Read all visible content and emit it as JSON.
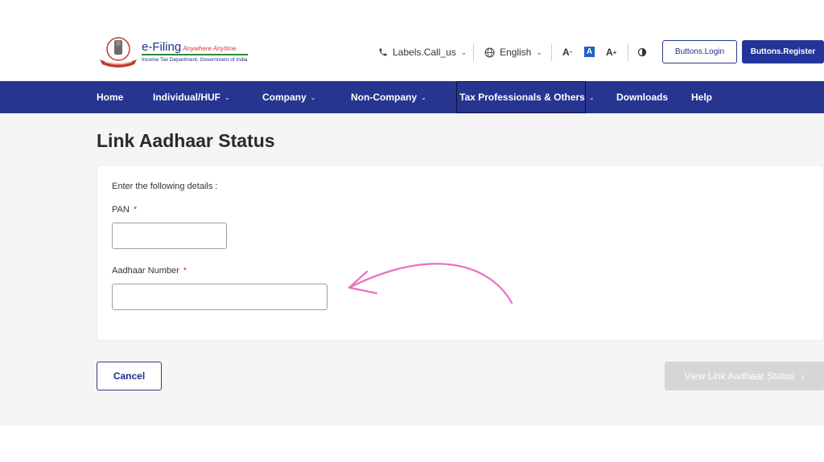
{
  "header": {
    "logo": {
      "brand": "e-Filing",
      "tagline": "Anywhere Anytime",
      "subtitle": "Income Tax Department, Government of India"
    },
    "call_us": "Labels.Call_us",
    "language": "English",
    "font_decrease": "A",
    "font_default": "A",
    "font_increase": "A",
    "login_label": "Buttons.Login",
    "register_label": "Buttons.Register"
  },
  "nav": {
    "items": [
      {
        "label": "Home"
      },
      {
        "label": "Individual/HUF"
      },
      {
        "label": "Company"
      },
      {
        "label": "Non-Company"
      },
      {
        "label": "Tax Professionals & Others"
      },
      {
        "label": "Downloads"
      },
      {
        "label": "Help"
      }
    ]
  },
  "page": {
    "title": "Link Aadhaar Status",
    "intro": "Enter the following details :",
    "pan_label": "PAN",
    "pan_value": "",
    "aadhaar_label": "Aadhaar Number",
    "aadhaar_value": "",
    "required_mark": "*"
  },
  "actions": {
    "cancel_label": "Cancel",
    "view_label": "View Link Aadhaar Status"
  },
  "colors": {
    "nav_bg": "#26358f",
    "primary": "#23359a",
    "annotation_arrow": "#ec6fc3",
    "disabled_button": "#d6d6d6"
  }
}
